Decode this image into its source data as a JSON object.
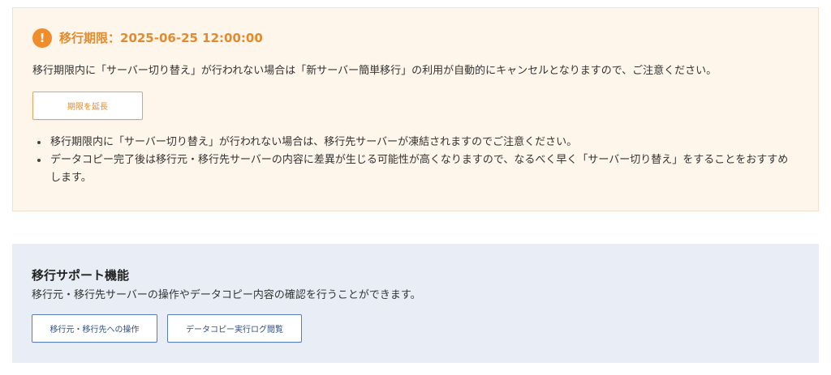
{
  "notice": {
    "icon": "exclamation-icon",
    "icon_glyph": "!",
    "deadline": "移行期限：2025-06-25 12:00:00",
    "description": "移行期限内に「サーバー切り替え」が行われない場合は「新サーバー簡単移行」の利用が自動的にキャンセルとなりますので、ご注意ください。",
    "extend_button": "期限を延長",
    "bullets": [
      "移行期限内に「サーバー切り替え」が行われない場合は、移行先サーバーが凍結されますのでご注意ください。",
      "データコピー完了後は移行元・移行先サーバーの内容に差異が生じる可能性が高くなりますので、なるべく早く「サーバー切り替え」をすることをおすすめします。"
    ],
    "accent_color": "#e58a2c",
    "background_color": "#fef6ea"
  },
  "support": {
    "title": "移行サポート機能",
    "description": "移行元・移行先サーバーの操作やデータコピー内容の確認を行うことができます。",
    "buttons": [
      "移行元・移行先への操作",
      "データコピー実行ログ閲覧"
    ],
    "background_color": "#e9eef6",
    "button_color": "#2f4f86"
  }
}
